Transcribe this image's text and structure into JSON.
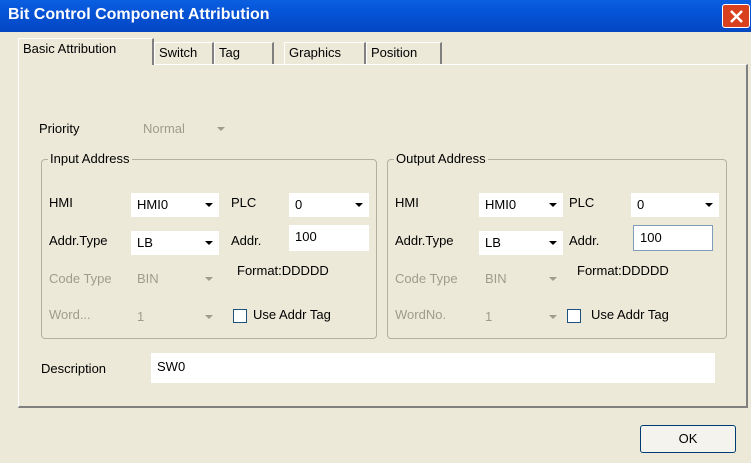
{
  "window": {
    "title": "Bit Control Component Attribution"
  },
  "tabs": [
    {
      "label": "Basic Attribution",
      "active": true
    },
    {
      "label": "Switch"
    },
    {
      "label": "Tag"
    },
    {
      "label": "Graphics"
    },
    {
      "label": "Position"
    }
  ],
  "priority": {
    "label": "Priority",
    "value": "Normal"
  },
  "input": {
    "legend": "Input Address",
    "hmi_label": "HMI",
    "hmi_value": "HMI0",
    "plc_label": "PLC",
    "plc_value": "0",
    "addr_type_label": "Addr.Type",
    "addr_type_value": "LB",
    "addr_label": "Addr.",
    "addr_value": "100",
    "code_type_label": "Code Type",
    "code_type_value": "BIN",
    "format": "Format:DDDDD",
    "word_label": "Word...",
    "word_value": "1",
    "use_tag_label": "Use Addr Tag"
  },
  "output": {
    "legend": "Output Address",
    "hmi_label": "HMI",
    "hmi_value": "HMI0",
    "plc_label": "PLC",
    "plc_value": "0",
    "addr_type_label": "Addr.Type",
    "addr_type_value": "LB",
    "addr_label": "Addr.",
    "addr_value": "100",
    "code_type_label": "Code Type",
    "code_type_value": "BIN",
    "format": "Format:DDDDD",
    "word_label": "WordNo.",
    "word_value": "1",
    "use_tag_label": "Use Addr Tag"
  },
  "description": {
    "label": "Description",
    "value": "SW0"
  },
  "buttons": {
    "ok": "OK"
  },
  "colors": {
    "titlebar": "#0553D6",
    "dialog_bg": "#ECE9D8",
    "close": "#D9411E"
  }
}
